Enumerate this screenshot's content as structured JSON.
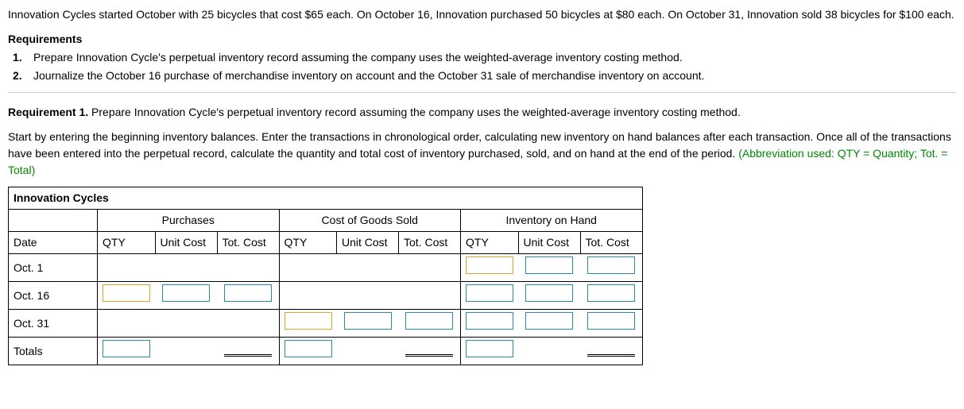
{
  "problem": "Innovation Cycles started October with 25 bicycles that cost $65 each. On October 16, Innovation purchased 50 bicycles at $80 each. On October 31, Innovation sold 38 bicycles for $100 each.",
  "requirements_heading": "Requirements",
  "requirements": [
    {
      "num": "1.",
      "text": "Prepare Innovation Cycle's perpetual inventory record assuming the company uses the weighted-average inventory costing method."
    },
    {
      "num": "2.",
      "text": "Journalize the October 16 purchase of merchandise inventory on account and the October 31 sale of merchandise inventory on account."
    }
  ],
  "req1": {
    "bold": "Requirement 1.",
    "rest": " Prepare Innovation Cycle's perpetual inventory record assuming the company uses the weighted-average inventory costing method."
  },
  "instructions": "Start by entering the beginning inventory balances. Enter the transactions in chronological order, calculating new inventory on hand balances after each transaction. Once all of the transactions have been entered into the perpetual record, calculate the quantity and total cost of inventory purchased, sold, and on hand at the end of the period. ",
  "abbrev": "(Abbreviation used: QTY = Quantity; Tot. = Total)",
  "table": {
    "company": "Innovation Cycles",
    "groups": {
      "purchases": "Purchases",
      "cogs": "Cost of Goods Sold",
      "onhand": "Inventory on Hand"
    },
    "cols": {
      "date": "Date",
      "qty": "QTY",
      "unitcost": "Unit Cost",
      "totcost": "Tot. Cost"
    },
    "rows": {
      "oct1": "Oct. 1",
      "oct16": "Oct. 16",
      "oct31": "Oct. 31",
      "totals": "Totals"
    }
  }
}
